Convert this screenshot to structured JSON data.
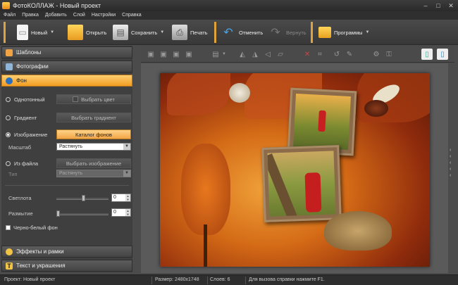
{
  "window": {
    "title": "ФотоКОЛЛАЖ - Новый проект",
    "controls": [
      "–",
      "□",
      "✕"
    ]
  },
  "menu": [
    "Файл",
    "Правка",
    "Добавить",
    "Слой",
    "Настройки",
    "Справка"
  ],
  "toolbar": {
    "new_label": "Новый",
    "open_label": "Открыть",
    "save_label": "Сохранить",
    "print_label": "Печать",
    "undo_label": "Отменить",
    "redo_label": "Вернуть",
    "programs_label": "Программы"
  },
  "left_panel": {
    "sections": {
      "templates": "Шаблоны",
      "photos": "Фотографии",
      "background": "Фон",
      "effects": "Эффекты и рамки",
      "text": "Текст и украшения"
    },
    "bg_options": {
      "solid": "Однотонный",
      "pick_color": "Выбрать цвет",
      "gradient": "Градиент",
      "pick_gradient": "Выбрать градиент",
      "image": "Изображение",
      "catalog": "Каталог фонов",
      "scale_label": "Масштаб",
      "scale_value": "Растянуть",
      "from_file": "Из файла",
      "pick_image": "Выбрать изображение",
      "type_label": "Тип",
      "type_value": "Растянуть",
      "selected": "image"
    },
    "adjust": {
      "brightness_label": "Светлота",
      "brightness_value": "0",
      "blur_label": "Размытие",
      "blur_value": "0",
      "bw_label": "Черно-белый фон",
      "bw_checked": false
    }
  },
  "status": {
    "project": "Проект:  Новый проект",
    "size": "Размер:  2480x1748",
    "layers": "Слоев:  6",
    "help": "Для вызова справки нажмите F1."
  },
  "colors": {
    "accent": "#f2a445",
    "panel": "#3f3f3f",
    "background": "#4b4b4b"
  }
}
